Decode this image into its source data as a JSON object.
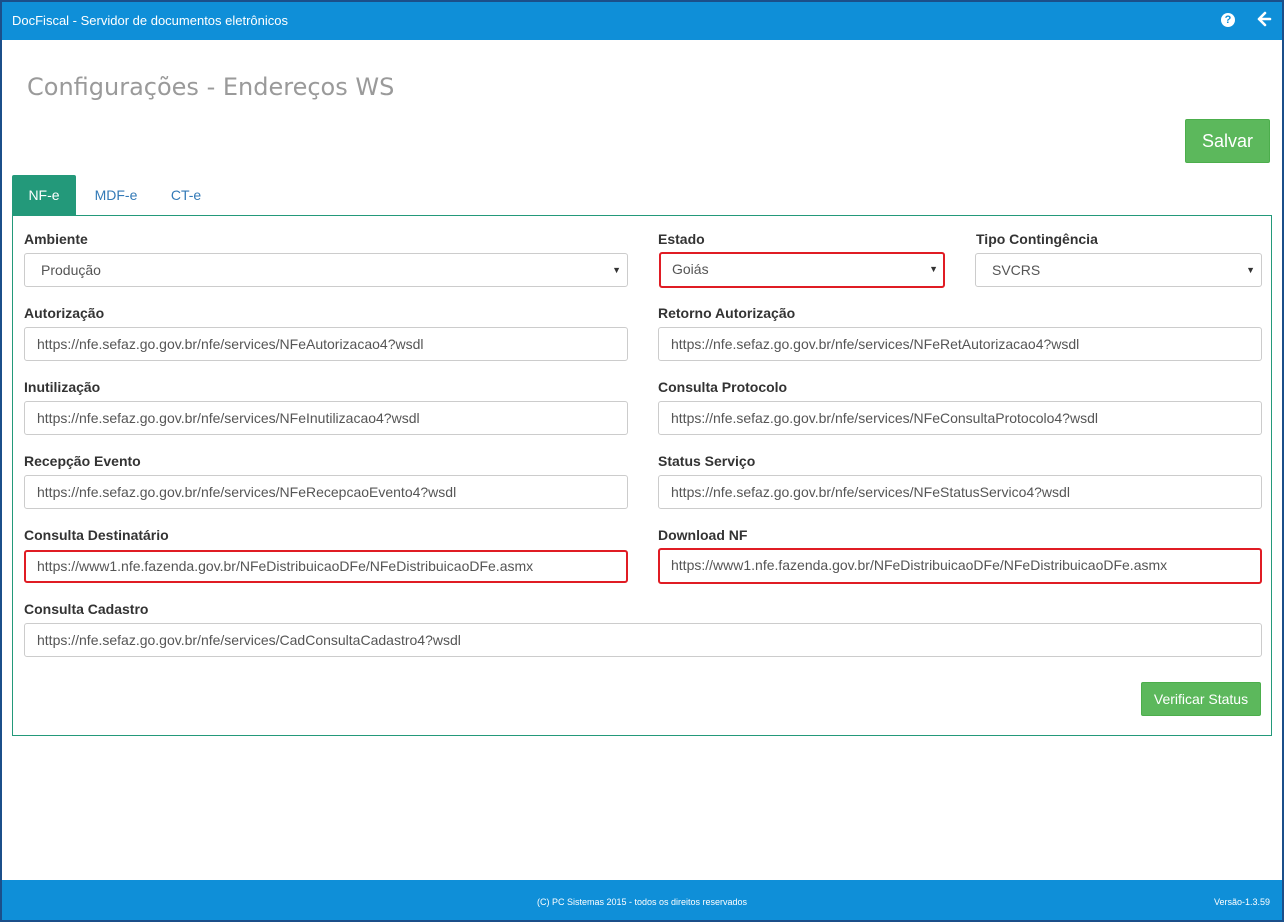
{
  "header": {
    "app_title": "DocFiscal - Servidor de documentos eletrônicos",
    "help_icon": "question-circle-icon",
    "back_icon": "arrow-left-icon"
  },
  "page": {
    "title": "Configurações - Endereços WS",
    "save_label": "Salvar"
  },
  "tabs": [
    {
      "label": "NF-e",
      "active": true
    },
    {
      "label": "MDF-e",
      "active": false
    },
    {
      "label": "CT-e",
      "active": false
    }
  ],
  "form": {
    "ambiente": {
      "label": "Ambiente",
      "value": "Produção"
    },
    "estado": {
      "label": "Estado",
      "value": "Goiás"
    },
    "tipo_contingencia": {
      "label": "Tipo Contingência",
      "value": "SVCRS"
    },
    "autorizacao": {
      "label": "Autorização",
      "value": "https://nfe.sefaz.go.gov.br/nfe/services/NFeAutorizacao4?wsdl"
    },
    "retorno_autorizacao": {
      "label": "Retorno Autorização",
      "value": "https://nfe.sefaz.go.gov.br/nfe/services/NFeRetAutorizacao4?wsdl"
    },
    "inutilizacao": {
      "label": "Inutilização",
      "value": "https://nfe.sefaz.go.gov.br/nfe/services/NFeInutilizacao4?wsdl"
    },
    "consulta_protocolo": {
      "label": "Consulta Protocolo",
      "value": "https://nfe.sefaz.go.gov.br/nfe/services/NFeConsultaProtocolo4?wsdl"
    },
    "recepcao_evento": {
      "label": "Recepção Evento",
      "value": "https://nfe.sefaz.go.gov.br/nfe/services/NFeRecepcaoEvento4?wsdl"
    },
    "status_servico": {
      "label": "Status Serviço",
      "value": "https://nfe.sefaz.go.gov.br/nfe/services/NFeStatusServico4?wsdl"
    },
    "consulta_destinatario": {
      "label": "Consulta Destinatário",
      "value": "https://www1.nfe.fazenda.gov.br/NFeDistribuicaoDFe/NFeDistribuicaoDFe.asmx"
    },
    "download_nf": {
      "label": "Download NF",
      "value": "https://www1.nfe.fazenda.gov.br/NFeDistribuicaoDFe/NFeDistribuicaoDFe.asmx"
    },
    "consulta_cadastro": {
      "label": "Consulta Cadastro",
      "value": "https://nfe.sefaz.go.gov.br/nfe/services/CadConsultaCadastro4?wsdl"
    },
    "verify_label": "Verificar Status"
  },
  "footer": {
    "copyright": "(C) PC Sistemas 2015 - todos os direitos reservados",
    "version": "Versão-1.3.59"
  },
  "colors": {
    "topbar": "#0f8fd8",
    "tab_active": "#23997a",
    "button_green": "#5cb85c",
    "highlight_red": "#e01c24"
  }
}
